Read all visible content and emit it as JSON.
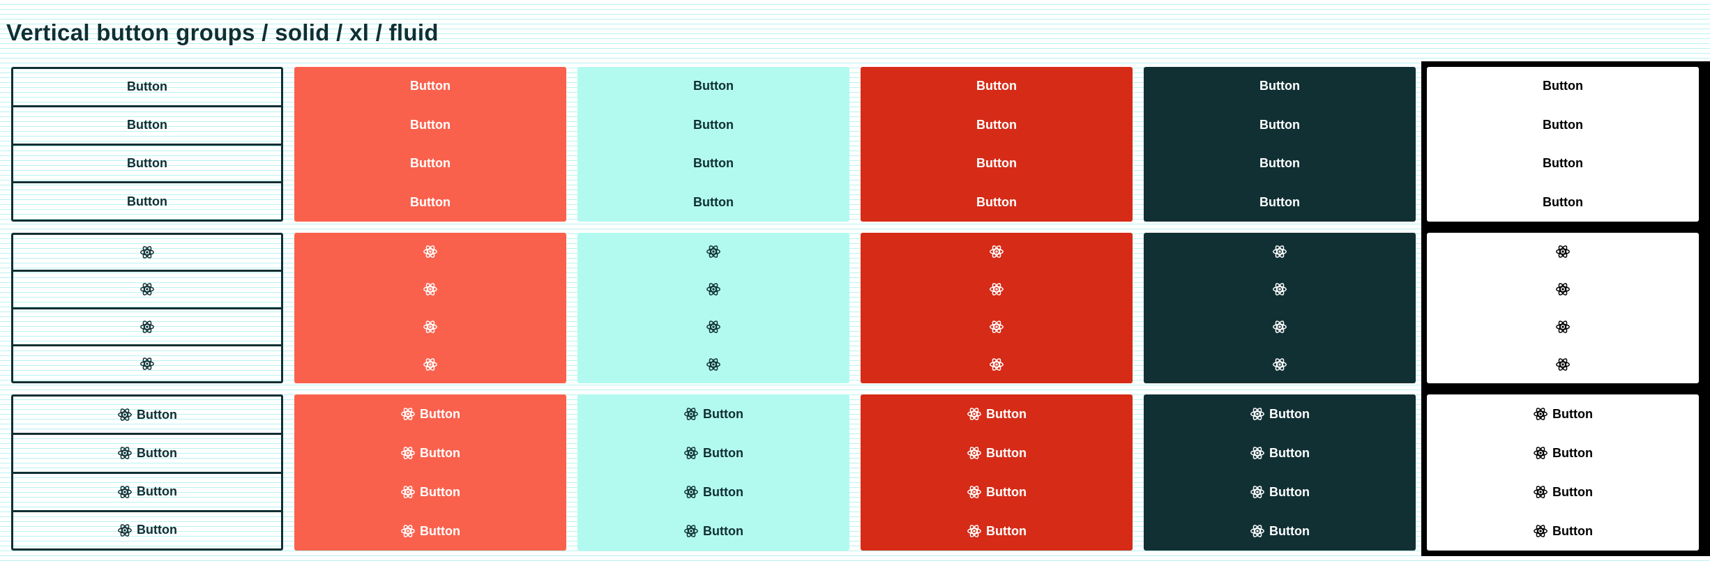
{
  "page": {
    "title": "Vertical button groups / solid / xl / fluid"
  },
  "button_label": "Button",
  "variants": [
    {
      "key": "outline",
      "fill": "transparent",
      "text_color": "#0f2f33"
    },
    {
      "key": "coral",
      "fill": "#fa614d",
      "text_color": "#ffffff"
    },
    {
      "key": "mint",
      "fill": "#b2faf0",
      "text_color": "#0f2f33"
    },
    {
      "key": "red",
      "fill": "#d62b17",
      "text_color": "#ffffff"
    },
    {
      "key": "dark",
      "fill": "#113034",
      "text_color": "#ffffff"
    },
    {
      "key": "white",
      "fill": "#ffffff",
      "text_color": "#000000"
    }
  ],
  "rows": [
    {
      "type": "label-only",
      "buttons_per_group": 4
    },
    {
      "type": "icon-only",
      "icon": "atom-icon",
      "buttons_per_group": 4
    },
    {
      "type": "icon-and-label",
      "icon": "atom-icon",
      "buttons_per_group": 4
    }
  ],
  "colors": {
    "grid_lines": "#b8f3ef",
    "title": "#0f2f33",
    "dark_panel": "#000000"
  }
}
